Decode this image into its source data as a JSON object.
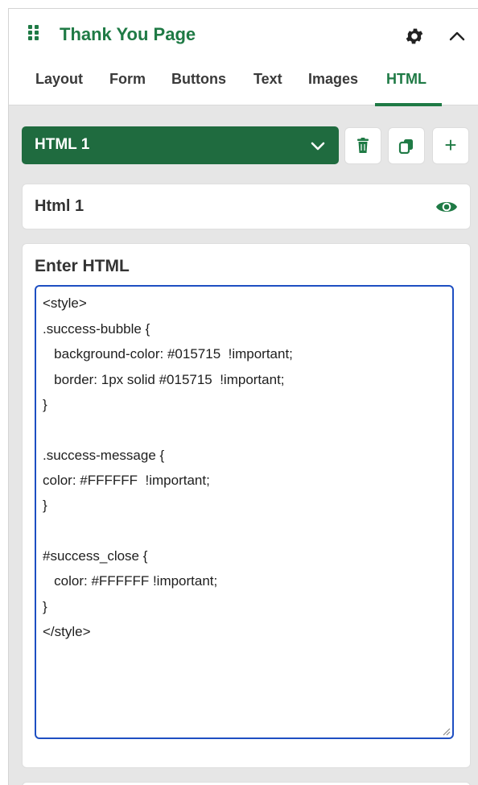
{
  "panel": {
    "title": "Thank You Page",
    "icons": [
      "drag-handle-icon",
      "gear-icon",
      "chevron-up-icon"
    ]
  },
  "tabs": [
    {
      "label": "Layout",
      "active": false
    },
    {
      "label": "Form",
      "active": false
    },
    {
      "label": "Buttons",
      "active": false
    },
    {
      "label": "Text",
      "active": false
    },
    {
      "label": "Images",
      "active": false
    },
    {
      "label": "HTML",
      "active": true
    }
  ],
  "html_block": {
    "selected": "HTML 1",
    "actions": [
      "trash-icon",
      "copy-icon",
      "plus-icon"
    ]
  },
  "block_name": {
    "value": "Html 1",
    "visibility_icon": "eye-icon"
  },
  "editor": {
    "label": "Enter HTML",
    "lines": [
      "<style>",
      ".success-bubble {",
      "   background-color: #015715  !important;",
      "   border: 1px solid #015715  !important;",
      "}",
      "",
      ".success-message {",
      "color: #FFFFFF  !important;",
      "}",
      "",
      "#success_close {",
      "   color: #FFFFFF !important;",
      "}",
      "</style>"
    ]
  },
  "colors": {
    "accent": "#1f7a45",
    "select_bg": "#1f6b3f",
    "focus_border": "#1e4fc2",
    "panel_bg": "#e6e6e6"
  }
}
